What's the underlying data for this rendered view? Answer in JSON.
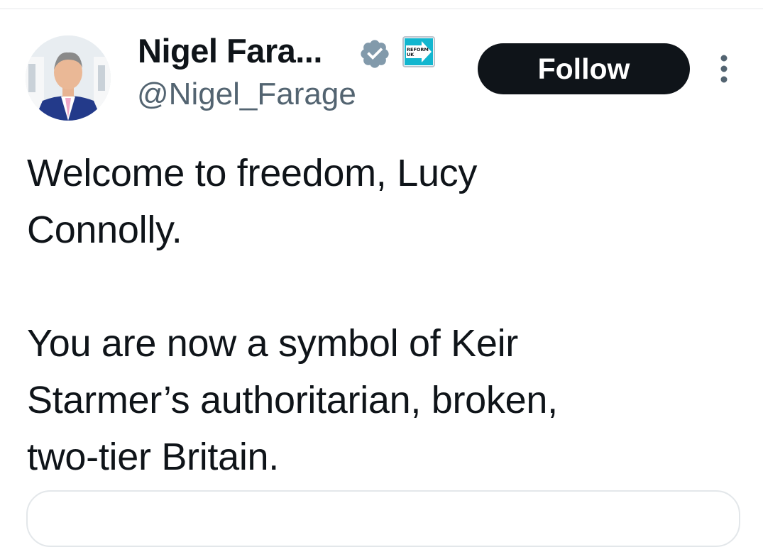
{
  "author": {
    "display_name": "Nigel Fara...",
    "handle": "@Nigel_Farage",
    "verified_icon": "verified-badge-icon",
    "affiliate_badge": {
      "icon": "reform-uk-logo",
      "text_line1": "REFORM",
      "text_line2": "UK",
      "color": "#12b6cf"
    }
  },
  "actions": {
    "follow_label": "Follow",
    "more_icon": "more-options-icon"
  },
  "tweet": {
    "paragraph1_line1": "Welcome to freedom, Lucy",
    "paragraph1_line2": "Connolly.",
    "paragraph2_line1": "You are now a symbol of Keir",
    "paragraph2_line2": "Starmer’s authoritarian, broken,",
    "paragraph2_line3": "two-tier Britain."
  },
  "colors": {
    "text": "#0f1419",
    "secondary_text": "#536471",
    "follow_bg": "#0f1419",
    "verified": "#829aab"
  }
}
